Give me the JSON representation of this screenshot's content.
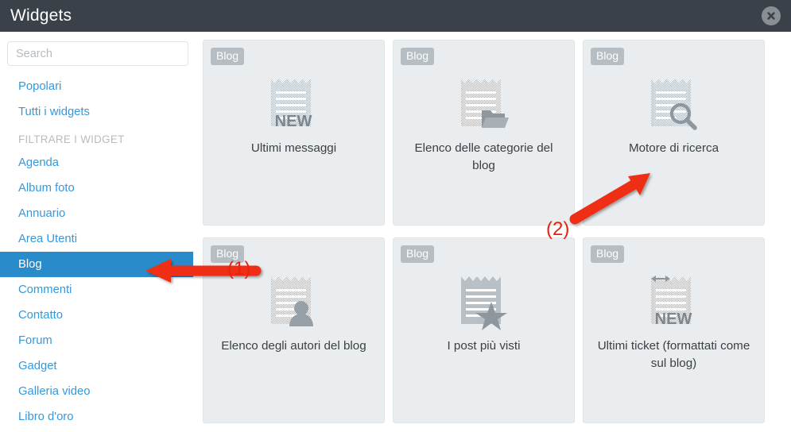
{
  "header": {
    "title": "Widgets",
    "close_icon": "close-circle-icon"
  },
  "sidebar": {
    "search": {
      "placeholder": "Search",
      "value": ""
    },
    "top_links": [
      {
        "label": "Popolari"
      },
      {
        "label": "Tutti i widgets"
      }
    ],
    "section_title": "FILTRARE I WIDGET",
    "filters": [
      {
        "label": "Agenda",
        "active": false
      },
      {
        "label": "Album foto",
        "active": false
      },
      {
        "label": "Annuario",
        "active": false
      },
      {
        "label": "Area Utenti",
        "active": false
      },
      {
        "label": "Blog",
        "active": true
      },
      {
        "label": "Commenti",
        "active": false
      },
      {
        "label": "Contatto",
        "active": false
      },
      {
        "label": "Forum",
        "active": false
      },
      {
        "label": "Gadget",
        "active": false
      },
      {
        "label": "Galleria video",
        "active": false
      },
      {
        "label": "Libro d'oro",
        "active": false
      }
    ],
    "active_color": "#2a8bca",
    "link_color": "#3598db"
  },
  "main": {
    "cards": [
      {
        "badge": "Blog",
        "label": "Ultimi messaggi",
        "icon": "notepad-new-icon"
      },
      {
        "badge": "Blog",
        "label": "Elenco delle categorie del blog",
        "icon": "notepad-folder-icon"
      },
      {
        "badge": "Blog",
        "label": "Motore di ricerca",
        "icon": "notepad-search-icon"
      },
      {
        "badge": "Blog",
        "label": "Elenco degli autori del blog",
        "icon": "notepad-user-icon"
      },
      {
        "badge": "Blog",
        "label": "I post più visti",
        "icon": "notepad-star-icon"
      },
      {
        "badge": "Blog",
        "label": "Ultimi ticket (formattati come sul blog)",
        "icon": "notepad-arrows-new-icon"
      }
    ]
  },
  "annotations": {
    "color": "#e8220d",
    "markers": [
      {
        "label": "(1)",
        "target": "sidebar-item-blog"
      },
      {
        "label": "(2)",
        "target": "card-motore-di-ricerca"
      }
    ]
  }
}
